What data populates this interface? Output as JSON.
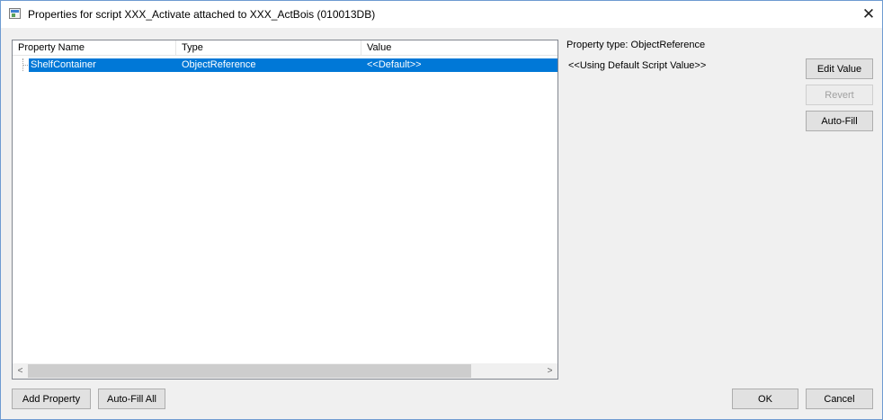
{
  "window": {
    "title": "Properties for script XXX_Activate attached to XXX_ActBois (010013DB)",
    "close_glyph": "✕"
  },
  "list": {
    "columns": [
      "Property Name",
      "Type",
      "Value"
    ],
    "rows": [
      {
        "name": "ShelfContainer",
        "type": "ObjectReference",
        "value": "<<Default>>",
        "selected": true
      }
    ],
    "scroll_left_glyph": "<",
    "scroll_right_glyph": ">"
  },
  "details": {
    "property_type": "Property type: ObjectReference",
    "value_text": "<<Using Default Script Value>>"
  },
  "buttons": {
    "edit_value": "Edit Value",
    "revert": "Revert",
    "auto_fill": "Auto-Fill",
    "add_property": "Add Property",
    "auto_fill_all": "Auto-Fill All",
    "ok": "OK",
    "cancel": "Cancel"
  },
  "colors": {
    "selection": "#0078d7",
    "window_border": "#6e9bd1"
  }
}
